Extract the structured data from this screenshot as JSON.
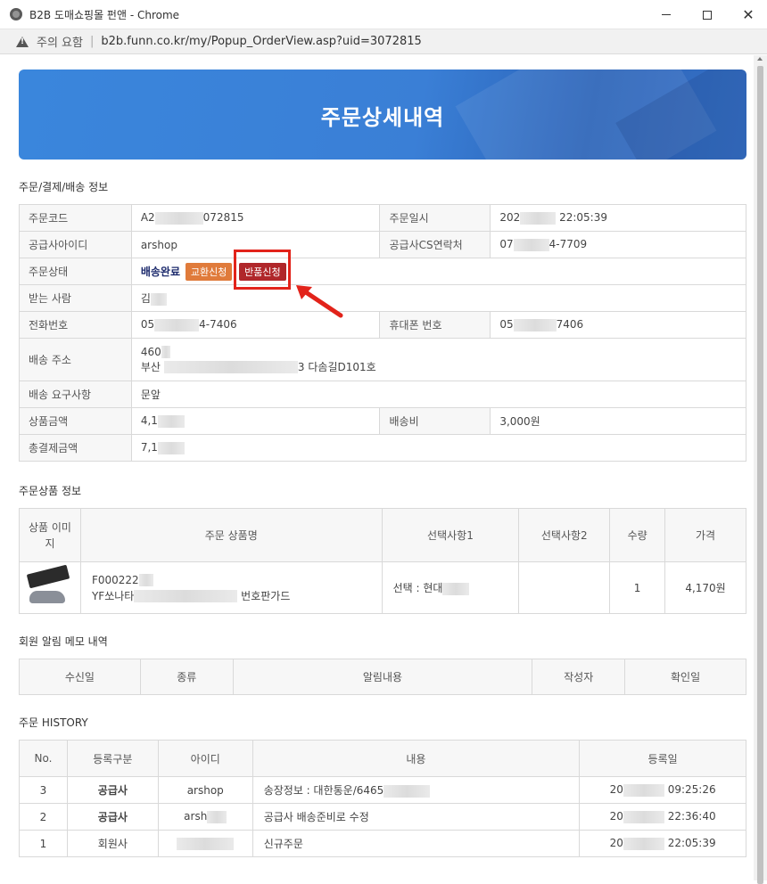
{
  "window": {
    "title": "B2B 도매쇼핑몰 펀앤 - Chrome",
    "warning": "주의 요함",
    "url": "b2b.funn.co.kr/my/Popup_OrderView.asp?uid=3072815"
  },
  "banner": {
    "title": "주문상세내역"
  },
  "order_section": {
    "title": "주문/결제/배송 정보",
    "labels": {
      "order_code": "주문코드",
      "order_date": "주문일시",
      "supplier_id": "공급사아이디",
      "supplier_cs": "공급사CS연락처",
      "status": "주문상태",
      "receiver": "받는 사람",
      "phone": "전화번호",
      "mobile": "휴대폰 번호",
      "address": "배송 주소",
      "request": "배송 요구사항",
      "product_amount": "상품금액",
      "shipping_fee": "배송비",
      "total_amount": "총결제금액"
    },
    "values": {
      "order_code_a": "A2",
      "order_code_b": "072815",
      "order_date_a": "202",
      "order_date_b": "22:05:39",
      "supplier_id": "arshop",
      "supplier_cs_a": "07",
      "supplier_cs_b": "4-7709",
      "status": "배송완료",
      "exchange_button": "교환신청",
      "return_button": "반품신청",
      "receiver": "김",
      "phone_a": "05",
      "phone_b": "4-7406",
      "mobile_a": "05",
      "mobile_b": "7406",
      "address_line1": "460",
      "address_line2_a": "부산",
      "address_line2_b": "3 다솜길D101호",
      "request": "문앞",
      "product_amount": "4,1",
      "shipping_fee": "3,000원",
      "total_amount": "7,1"
    }
  },
  "product_section": {
    "title": "주문상품 정보",
    "headers": [
      "상품 이미지",
      "주문 상품명",
      "선택사항1",
      "선택사항2",
      "수량",
      "가격"
    ],
    "row": {
      "code": "F000222",
      "name_a": "YF쏘나타",
      "name_b": "번호판가드",
      "option1": "선택 : 현대",
      "option2": "",
      "qty": "1",
      "price": "4,170원"
    }
  },
  "memo_section": {
    "title": "회원 알림 메모 내역",
    "headers": [
      "수신일",
      "종류",
      "알림내용",
      "작성자",
      "확인일"
    ]
  },
  "history_section": {
    "title": "주문 HISTORY",
    "headers": [
      "No.",
      "등록구분",
      "아이디",
      "내용",
      "등록일"
    ],
    "rows": [
      {
        "no": "3",
        "type": "공급사",
        "id": "arshop",
        "content": "송장정보 : 대한통운/6465",
        "date_a": "20",
        "date_b": "09:25:26"
      },
      {
        "no": "2",
        "type": "공급사",
        "id": "arsh",
        "content": "공급사 배송준비로 수정",
        "date_a": "20",
        "date_b": "22:36:40"
      },
      {
        "no": "1",
        "type": "회원사",
        "id": "",
        "content": "신규주문",
        "date_a": "20",
        "date_b": "22:05:39"
      }
    ]
  },
  "colors": {
    "banner": "#3a86dc",
    "exchange_button": "#e07b3b",
    "return_button": "#b0272a",
    "highlight": "#e2231a",
    "supplier_text": "#2c7a2c",
    "member_text": "#3b6bc7"
  }
}
